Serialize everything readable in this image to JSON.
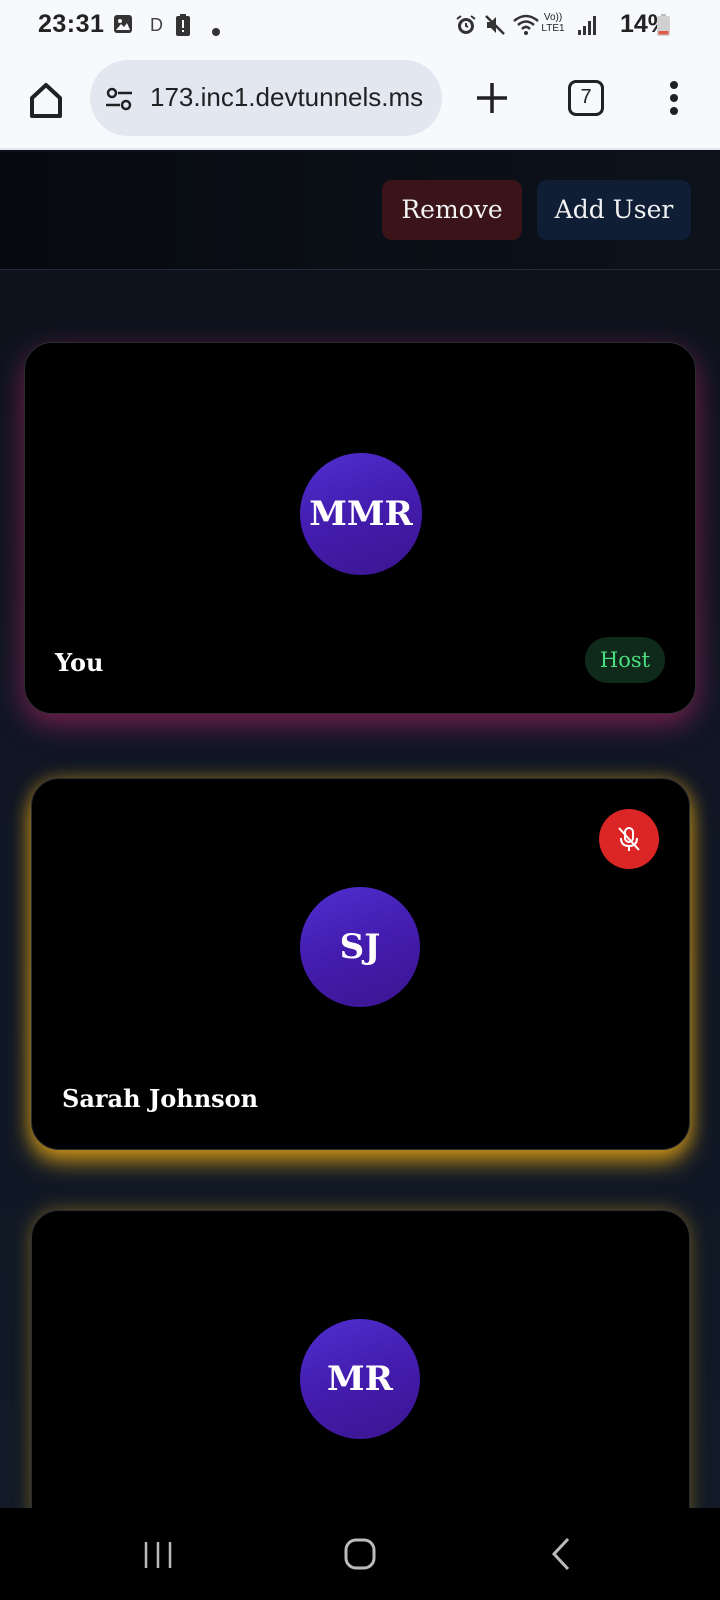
{
  "status_bar": {
    "time": "23:31",
    "carrier_indicator": "D",
    "network_label": "Vo)) LTE1",
    "battery": "14%",
    "icons": [
      "gallery-icon",
      "battery-alert-icon",
      "dot-icon",
      "alarm-icon",
      "mute-icon",
      "wifi-icon",
      "signal-icon",
      "battery-icon"
    ]
  },
  "browser": {
    "url": "173.inc1.devtunnels.ms",
    "tab_count": "7",
    "icons": [
      "home-icon",
      "site-settings-icon",
      "plus-icon",
      "tabs-icon",
      "more-vert-icon"
    ]
  },
  "header": {
    "remove_label": "Remove",
    "add_user_label": "Add User"
  },
  "participants": [
    {
      "initials": "MMR",
      "name": "You",
      "badge": "Host",
      "glow_color": "#c8286e"
    },
    {
      "initials": "SJ",
      "name": "Sarah Johnson",
      "muted": true,
      "glow_color": "#ebaa14"
    },
    {
      "initials": "MR",
      "name": "",
      "glow_color": "#dca014"
    }
  ],
  "colors": {
    "avatar": "#4f2fd0",
    "mute": "#dc2626",
    "host_text": "#4ade80",
    "remove_bg": "#3a1419",
    "add_bg": "#0f1d35"
  },
  "nav_bar": {
    "icons": [
      "recents-icon",
      "home-nav-icon",
      "back-icon"
    ]
  }
}
